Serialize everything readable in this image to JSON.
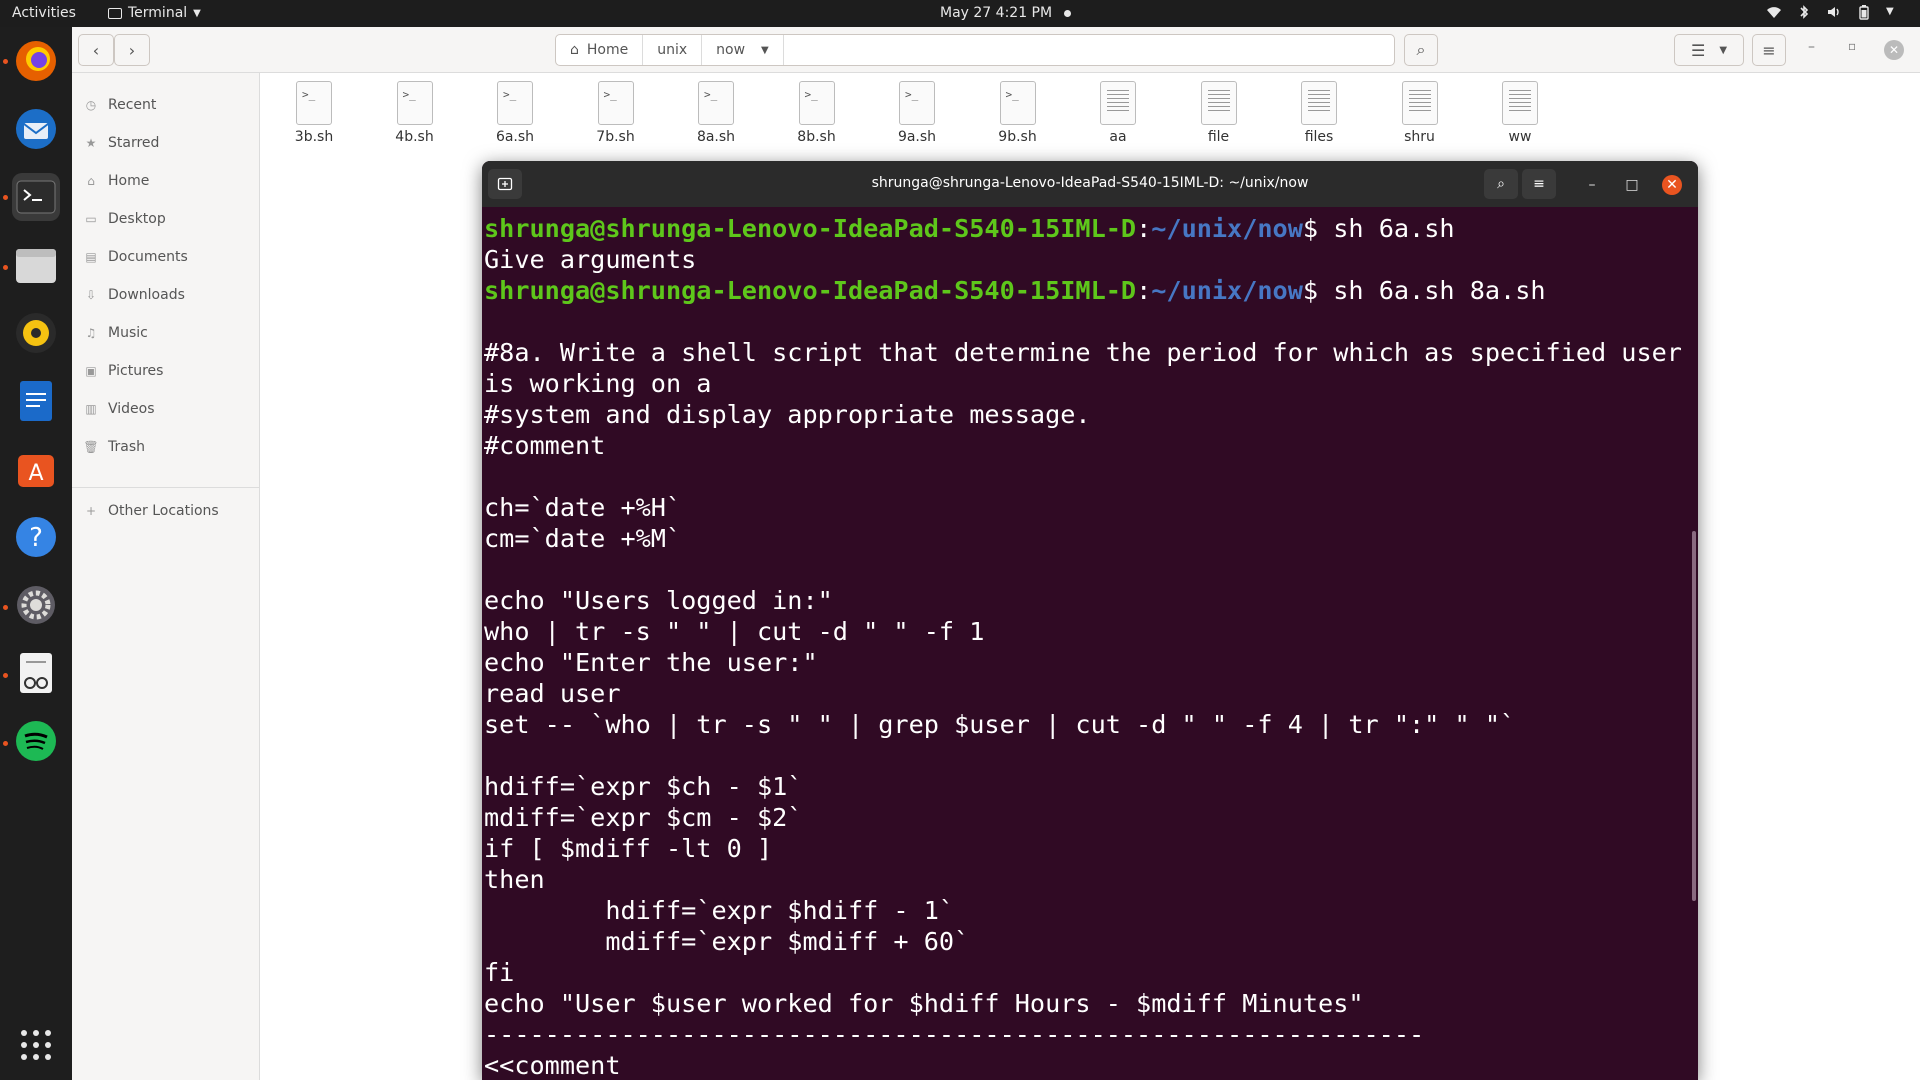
{
  "topbar": {
    "activities": "Activities",
    "app_name": "Terminal",
    "clock": "May 27  4:21 PM"
  },
  "dock": {
    "apps": [
      "firefox-icon",
      "thunderbird-icon",
      "terminal-icon",
      "files-icon",
      "rhythmbox-icon",
      "writer-icon",
      "software-icon",
      "help-icon",
      "settings-icon",
      "document-viewer-icon",
      "spotify-icon",
      "app-grid-icon"
    ]
  },
  "files": {
    "breadcrumbs": [
      "Home",
      "unix",
      "now"
    ],
    "sidebar": [
      "Recent",
      "Starred",
      "Home",
      "Desktop",
      "Documents",
      "Downloads",
      "Music",
      "Pictures",
      "Videos",
      "Trash"
    ],
    "other_locations": "Other Locations",
    "items": [
      {
        "name": "3b.sh",
        "kind": "script"
      },
      {
        "name": "4b.sh",
        "kind": "script"
      },
      {
        "name": "6a.sh",
        "kind": "script"
      },
      {
        "name": "7b.sh",
        "kind": "script"
      },
      {
        "name": "8a.sh",
        "kind": "script"
      },
      {
        "name": "8b.sh",
        "kind": "script"
      },
      {
        "name": "9a.sh",
        "kind": "script"
      },
      {
        "name": "9b.sh",
        "kind": "script"
      },
      {
        "name": "aa",
        "kind": "text"
      },
      {
        "name": "file",
        "kind": "text"
      },
      {
        "name": "files",
        "kind": "text"
      },
      {
        "name": "shru",
        "kind": "text"
      },
      {
        "name": "ww",
        "kind": "text"
      }
    ]
  },
  "terminal": {
    "title": "shrunga@shrunga-Lenovo-IdeaPad-S540-15IML-D: ~/unix/now",
    "prompt_user": "shrunga@shrunga-Lenovo-IdeaPad-S540-15IML-D",
    "prompt_path": "~/unix/now",
    "lines": [
      {
        "type": "prompt",
        "cmd": "$ sh 6a.sh"
      },
      {
        "type": "out",
        "text": "Give arguments"
      },
      {
        "type": "prompt",
        "cmd": "$ sh 6a.sh 8a.sh"
      },
      {
        "type": "out",
        "text": ""
      },
      {
        "type": "out",
        "text": "#8a. Write a shell script that determine the period for which as specified user"
      },
      {
        "type": "out",
        "text": "is working on a"
      },
      {
        "type": "out",
        "text": "#system and display appropriate message."
      },
      {
        "type": "out",
        "text": "#comment"
      },
      {
        "type": "out",
        "text": ""
      },
      {
        "type": "out",
        "text": "ch=`date +%H`"
      },
      {
        "type": "out",
        "text": "cm=`date +%M`"
      },
      {
        "type": "out",
        "text": ""
      },
      {
        "type": "out",
        "text": "echo \"Users logged in:\""
      },
      {
        "type": "out",
        "text": "who | tr -s \" \" | cut -d \" \" -f 1"
      },
      {
        "type": "out",
        "text": "echo \"Enter the user:\""
      },
      {
        "type": "out",
        "text": "read user"
      },
      {
        "type": "out",
        "text": "set -- `who | tr -s \" \" | grep $user | cut -d \" \" -f 4 | tr \":\" \" \"`"
      },
      {
        "type": "out",
        "text": ""
      },
      {
        "type": "out",
        "text": "hdiff=`expr $ch - $1`"
      },
      {
        "type": "out",
        "text": "mdiff=`expr $cm - $2`"
      },
      {
        "type": "out",
        "text": "if [ $mdiff -lt 0 ]"
      },
      {
        "type": "out",
        "text": "then"
      },
      {
        "type": "out",
        "text": "        hdiff=`expr $hdiff - 1`"
      },
      {
        "type": "out",
        "text": "        mdiff=`expr $mdiff + 60`"
      },
      {
        "type": "out",
        "text": "fi"
      },
      {
        "type": "out",
        "text": "echo \"User $user worked for $hdiff Hours - $mdiff Minutes\""
      },
      {
        "type": "out",
        "text": "--------------------------------------------------------------"
      },
      {
        "type": "out",
        "text": "<<comment"
      }
    ]
  },
  "colors": {
    "terminal_bg": "#300a24",
    "prompt_user": "#5ec71b",
    "prompt_path": "#4777c4",
    "accent": "#e95420"
  }
}
